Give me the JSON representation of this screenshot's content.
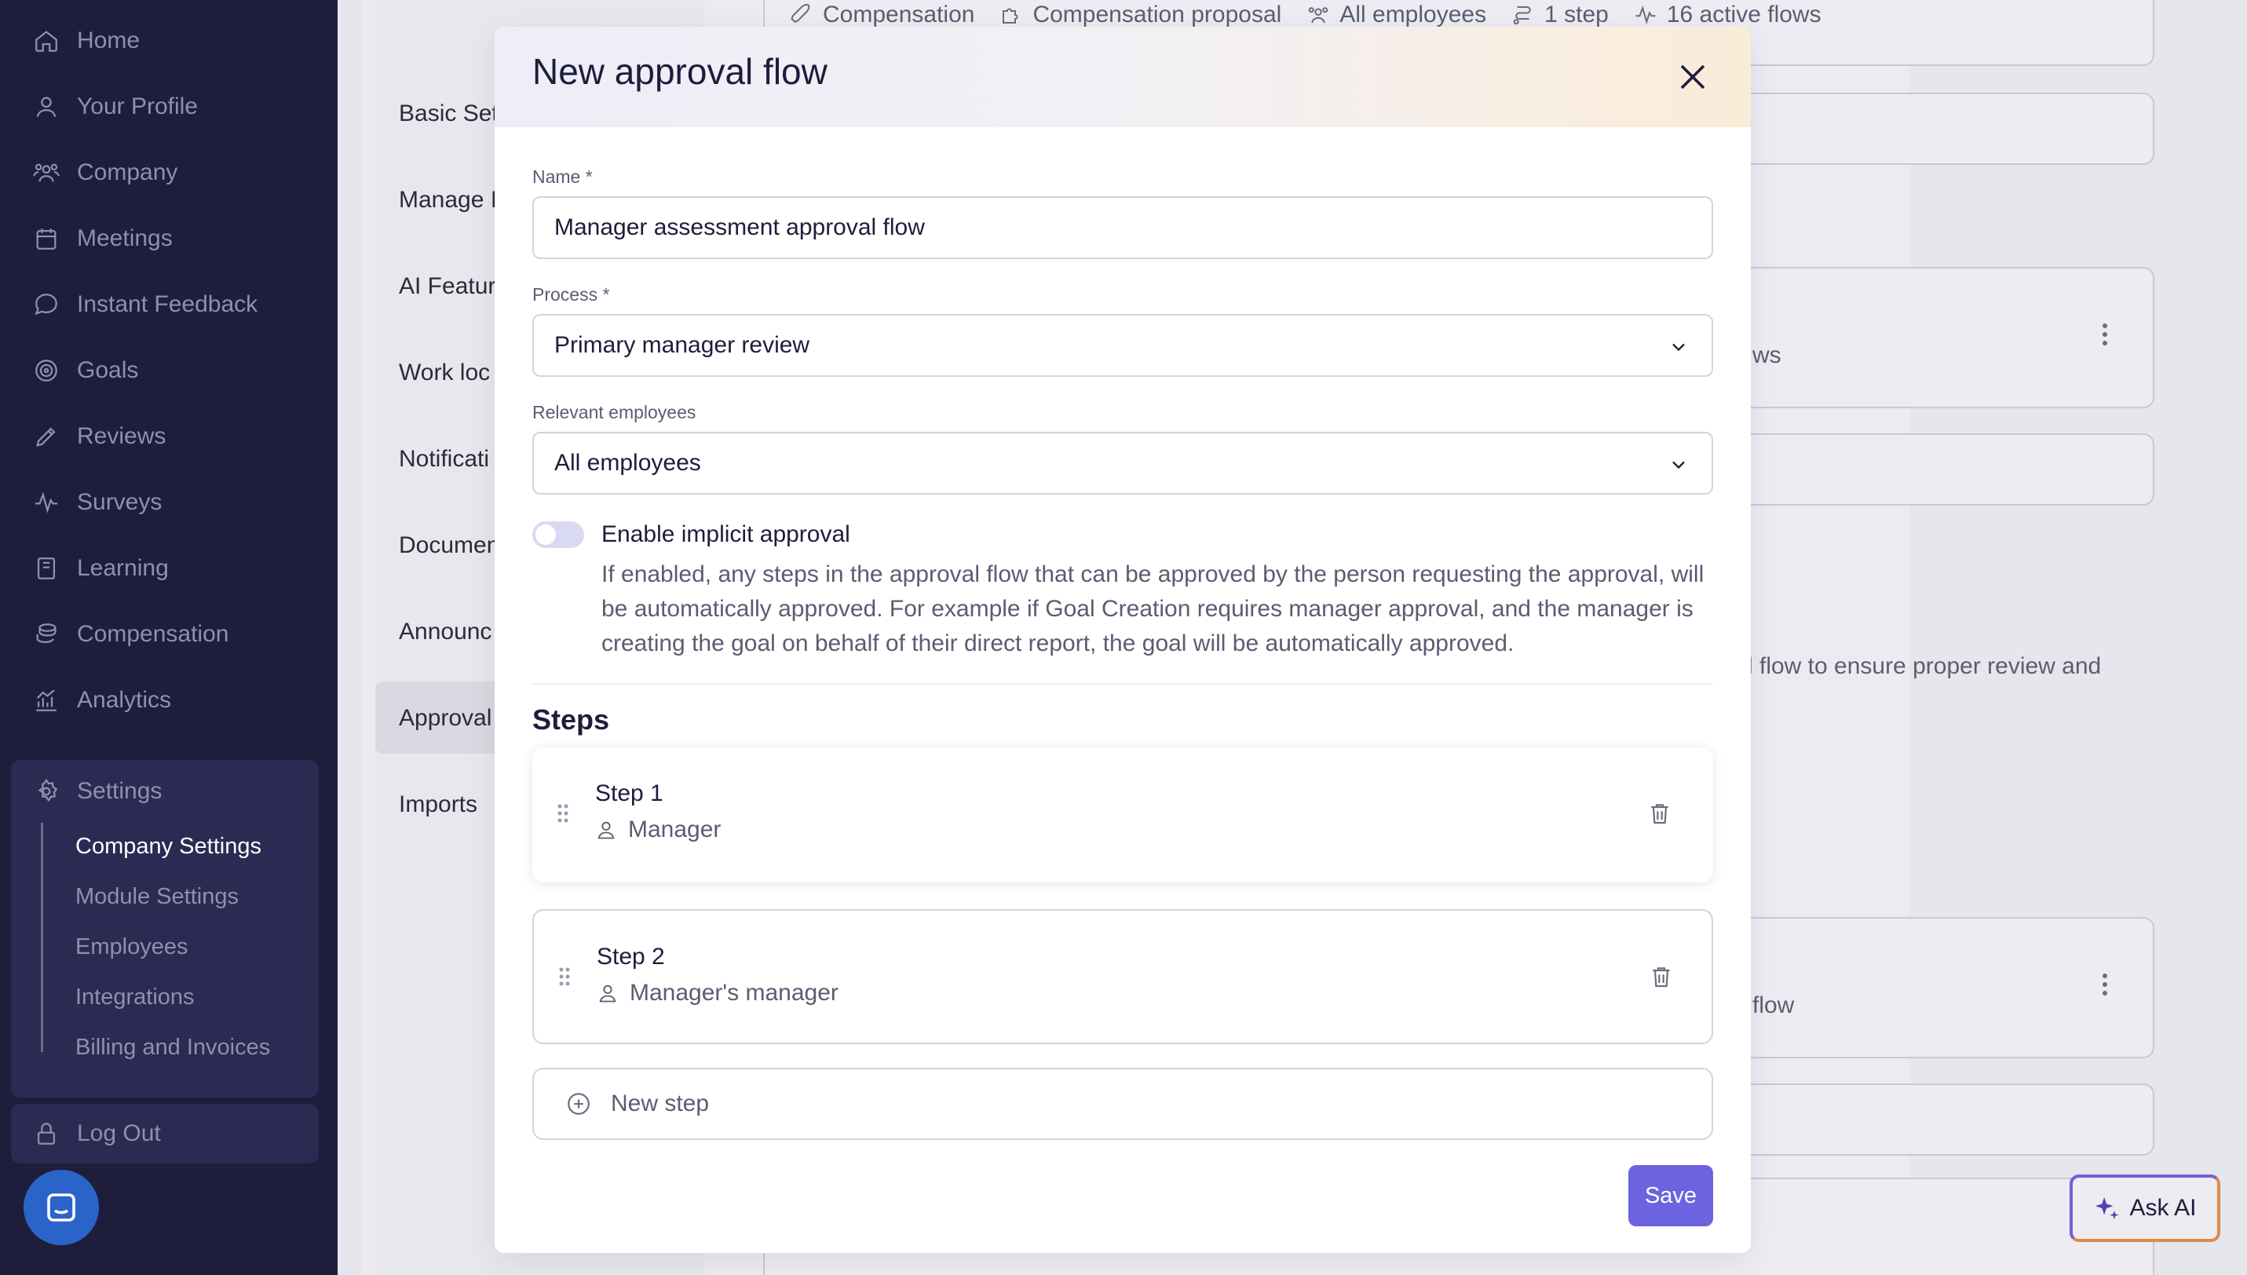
{
  "sidebar": {
    "items": [
      {
        "label": "Home",
        "icon": "home-icon"
      },
      {
        "label": "Your Profile",
        "icon": "user-icon"
      },
      {
        "label": "Company",
        "icon": "users-icon"
      },
      {
        "label": "Meetings",
        "icon": "calendar-icon"
      },
      {
        "label": "Instant Feedback",
        "icon": "chat-icon"
      },
      {
        "label": "Goals",
        "icon": "target-icon"
      },
      {
        "label": "Reviews",
        "icon": "pencil-icon"
      },
      {
        "label": "Surveys",
        "icon": "pulse-icon"
      },
      {
        "label": "Learning",
        "icon": "book-icon"
      },
      {
        "label": "Compensation",
        "icon": "coins-icon"
      },
      {
        "label": "Analytics",
        "icon": "chart-icon"
      }
    ],
    "settings": {
      "label": "Settings",
      "sub_items": [
        "Company Settings",
        "Module Settings",
        "Employees",
        "Integrations",
        "Billing and Invoices"
      ]
    },
    "logout_label": "Log Out"
  },
  "settings_nav": {
    "items": [
      "Basic Set",
      "Manage I",
      "AI Featur",
      "Work loc",
      "Notificati",
      "Documen",
      "Announc",
      "Approval",
      "Imports"
    ]
  },
  "background": {
    "top_row": [
      "Compensation",
      "Compensation proposal",
      "All employees",
      "1 step",
      "16 active flows"
    ],
    "card2_text": "ws",
    "description_fragment": "l flow to ensure proper review and",
    "card_bottom_text": "flow"
  },
  "ask_ai_label": "Ask AI",
  "modal": {
    "title": "New approval flow",
    "name_label": "Name *",
    "name_value": "Manager assessment approval flow",
    "process_label": "Process *",
    "process_value": "Primary manager review",
    "employees_label": "Relevant employees",
    "employees_value": "All employees",
    "implicit_label": "Enable implicit approval",
    "implicit_enabled": false,
    "implicit_desc": "If enabled, any steps in the approval flow that can be approved by the person requesting the approval, will be automatically approved. For example if Goal Creation requires manager approval, and the manager is creating the goal on behalf of their direct report, the goal will be automatically approved.",
    "steps_title": "Steps",
    "steps": [
      {
        "name": "Step 1",
        "role": "Manager"
      },
      {
        "name": "Step 2",
        "role": "Manager's manager"
      }
    ],
    "new_step_label": "New step",
    "save_label": "Save"
  },
  "colors": {
    "sidebar_bg": "#1e1d3c",
    "primary": "#6b63e0",
    "chat_button": "#2b64c9"
  }
}
